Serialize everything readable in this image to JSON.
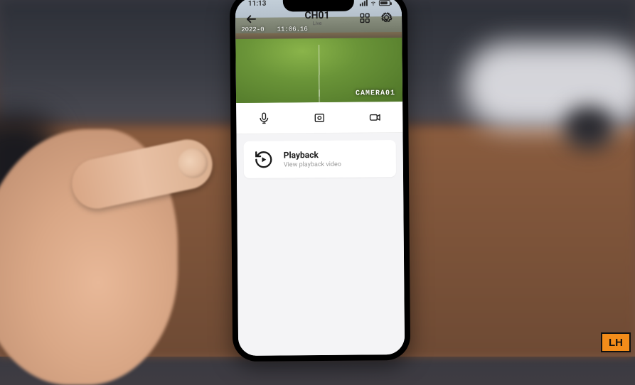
{
  "status": {
    "time": "11:13"
  },
  "header": {
    "title": "CH01",
    "subtitle": "Live"
  },
  "feed": {
    "timestamp_date": "2022-0",
    "timestamp_time": "11:06.16",
    "camera_label": "CAMERA01"
  },
  "playback": {
    "title": "Playback",
    "subtitle": "View playback video"
  },
  "badge": {
    "text": "LH"
  }
}
